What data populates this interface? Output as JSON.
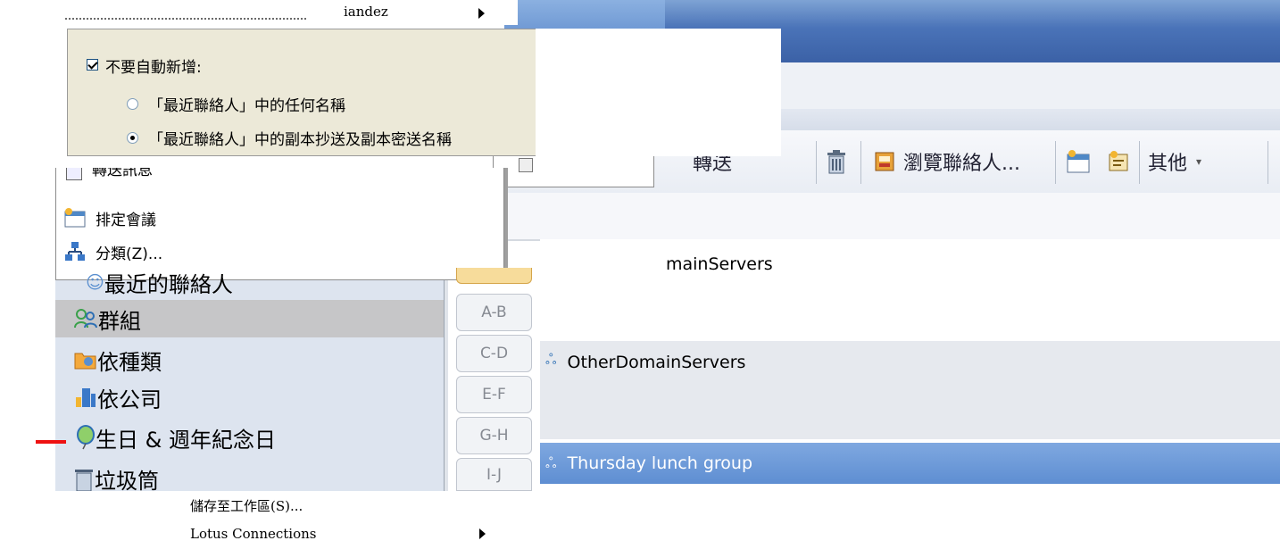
{
  "top_menu": {
    "item_label": "iandez"
  },
  "options_popup": {
    "checkbox_label": "不要自動新增:",
    "radio_any": "「最近聯絡人」中的任何名稱",
    "radio_cc_bcc": "「最近聯絡人」中的副本抄送及副本密送名稱"
  },
  "context_menu": {
    "forward_partial": "轉送訊息",
    "schedule_meeting": "排定會議",
    "categorize": "分類(Z)..."
  },
  "toolbar": {
    "forward_label": "轉送",
    "browse_contacts_label": "瀏覽聯絡人...",
    "more_label": "其他"
  },
  "navigation": {
    "recent_contacts": "最近的聯絡人",
    "groups": "群組",
    "by_category": "依種類",
    "by_company": "依公司",
    "birthdays": "生日 & 週年紀念日",
    "trash": "垃圾筒"
  },
  "alpha_index": [
    "A-B",
    "C-D",
    "E-F",
    "G-H",
    "I-J"
  ],
  "groups_list": {
    "row1": "mainServers",
    "row2": "OtherDomainServers",
    "row3": "Thursday lunch group"
  },
  "bottom_menu": {
    "save_to_workspace": "儲存至工作區(S)...",
    "lotus_connections": "Lotus Connections"
  }
}
